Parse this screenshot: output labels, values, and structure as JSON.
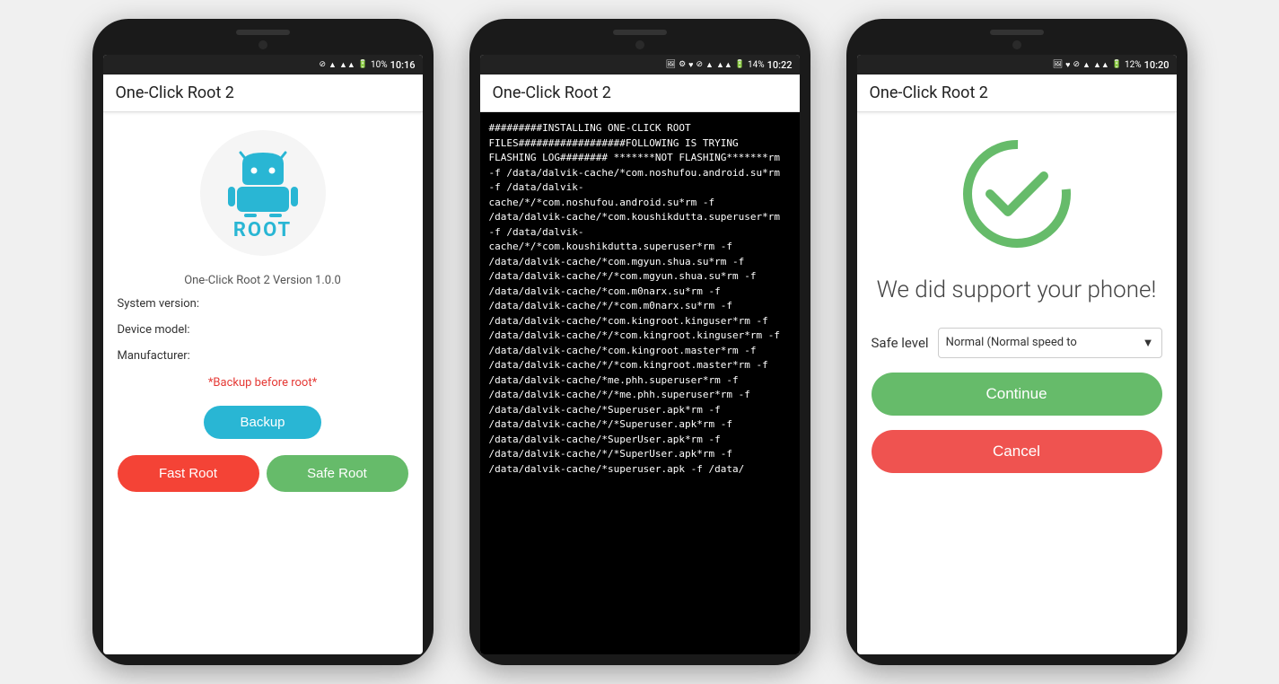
{
  "phone1": {
    "statusBar": {
      "battery": "10%",
      "time": "10:16"
    },
    "appTitle": "One-Click Root 2",
    "androidLogo": "ROOT",
    "version": "One-Click Root 2 Version 1.0.0",
    "fields": [
      {
        "label": "System version:"
      },
      {
        "label": "Device model:"
      },
      {
        "label": "Manufacturer:"
      }
    ],
    "backupWarning": "*Backup before root*",
    "backupBtn": "Backup",
    "fastRootBtn": "Fast Root",
    "safeRootBtn": "Safe Root"
  },
  "phone2": {
    "statusBar": {
      "battery": "14%",
      "time": "10:22"
    },
    "appTitle": "One-Click Root 2",
    "logText": "#########INSTALLING ONE-CLICK ROOT FILES##################FOLLOWING IS TRYING FLASHING LOG######## *******NOT FLASHING*******rm -f /data/dalvik-cache/*com.noshufou.android.su*rm -f /data/dalvik-cache/*/*com.noshufou.android.su*rm -f /data/dalvik-cache/*com.koushikdutta.superuser*rm -f /data/dalvik-cache/*/*com.koushikdutta.superuser*rm -f /data/dalvik-cache/*com.mgyun.shua.su*rm -f /data/dalvik-cache/*/*com.mgyun.shua.su*rm -f /data/dalvik-cache/*com.m0narx.su*rm -f /data/dalvik-cache/*/*com.m0narx.su*rm -f /data/dalvik-cache/*com.kingroot.kinguser*rm -f /data/dalvik-cache/*/*com.kingroot.kinguser*rm -f /data/dalvik-cache/*com.kingroot.master*rm -f /data/dalvik-cache/*/*com.kingroot.master*rm -f /data/dalvik-cache/*me.phh.superuser*rm -f /data/dalvik-cache/*/*me.phh.superuser*rm -f /data/dalvik-cache/*Superuser.apk*rm -f /data/dalvik-cache/*/*Superuser.apk*rm -f /data/dalvik-cache/*SuperUser.apk*rm -f /data/dalvik-cache/*/*SuperUser.apk*rm -f /data/dalvik-cache/*superuser.apk -f /data/"
  },
  "phone3": {
    "statusBar": {
      "battery": "12%",
      "time": "10:20"
    },
    "appTitle": "One-Click Root 2",
    "successText": "We did support your phone!",
    "safeLevelLabel": "Safe level",
    "safeLevelOption": "Normal (Normal speed to",
    "continueBtn": "Continue",
    "cancelBtn": "Cancel"
  }
}
